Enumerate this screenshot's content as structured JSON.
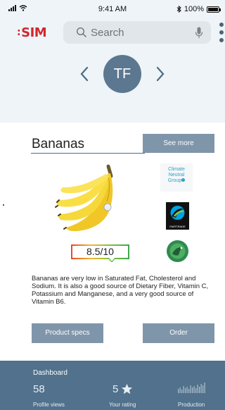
{
  "status_bar": {
    "time": "9:41 AM",
    "battery": "100%",
    "battery_level": 1.0
  },
  "header": {
    "logo": "SIM",
    "search": {
      "placeholder": "Search"
    }
  },
  "profile": {
    "initials": "TF"
  },
  "product": {
    "name": "Bananas",
    "see_more_label": "See more",
    "rating": "8.5/10",
    "description": "Bananas are very low in Saturated Fat, Cholesterol and Sodium. It is also a good source of Dietary Fiber, Vitamin C, Potassium and Manganese, and a very good source of Vitamin B6.",
    "certifications": {
      "climate_neutral": [
        "Climate",
        "Neutral",
        "Group"
      ],
      "fairtrade": "FAIRTRADE"
    },
    "product_specs_label": "Product specs",
    "order_label": "Order"
  },
  "dashboard": {
    "title": "Dashboard",
    "profile_views": {
      "value": "58",
      "label": "Profile views"
    },
    "rating": {
      "value": "5",
      "label": "Your rating"
    },
    "production": {
      "label": "Production"
    }
  },
  "colors": {
    "brand": "#d3262e",
    "accent": "#5c7890",
    "button": "#7f95aa",
    "dashboard": "#51718c",
    "top_background": "#eef4f7"
  }
}
